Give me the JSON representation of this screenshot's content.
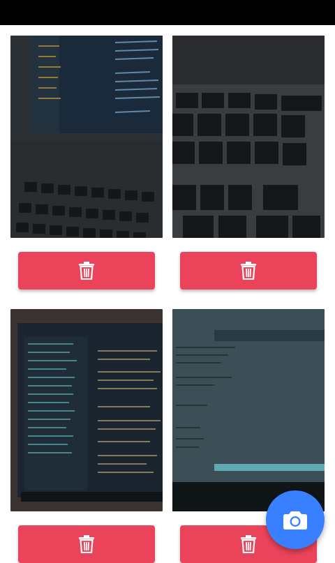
{
  "status_bar": {},
  "gallery": {
    "photos": [
      {
        "subject": "laptop-code-editor-keyboard",
        "delete_icon": "trash-icon"
      },
      {
        "subject": "keyboard-closeup",
        "delete_icon": "trash-icon"
      },
      {
        "subject": "laptop-screen-editor",
        "delete_icon": "trash-icon"
      },
      {
        "subject": "laptop-screen-code",
        "delete_icon": "trash-icon"
      }
    ]
  },
  "fab": {
    "icon": "camera-icon"
  },
  "colors": {
    "delete": "#eb445a",
    "fab": "#3880ff",
    "status_bar": "#000000"
  }
}
